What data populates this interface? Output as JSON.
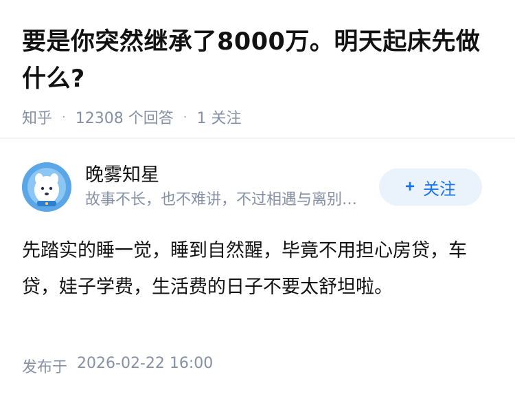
{
  "question": {
    "title": "要是你突然继承了8000万。明天起床先做什么?",
    "source": "知乎",
    "answer_count": "12308 个回答",
    "follow_count": "1 关注"
  },
  "answer": {
    "author_name": "晚雾知星",
    "author_bio": "故事不长，也不难讲，不过相遇与离别罢了",
    "follow_label": "关注",
    "follow_icon": "plus-icon",
    "content": "先踏实的睡一觉，睡到自然醒，毕竟不用担心房贷，车贷，娃子学费，生活费的日子不要太舒坦啦。",
    "publish_label": "发布于",
    "publish_time": "2026-02-22 16:00"
  },
  "colors": {
    "accent": "#1772f6",
    "follow_bg": "#eaf2fb",
    "meta_text": "#8590a6",
    "avatar_bg": "#5aa6e6"
  }
}
